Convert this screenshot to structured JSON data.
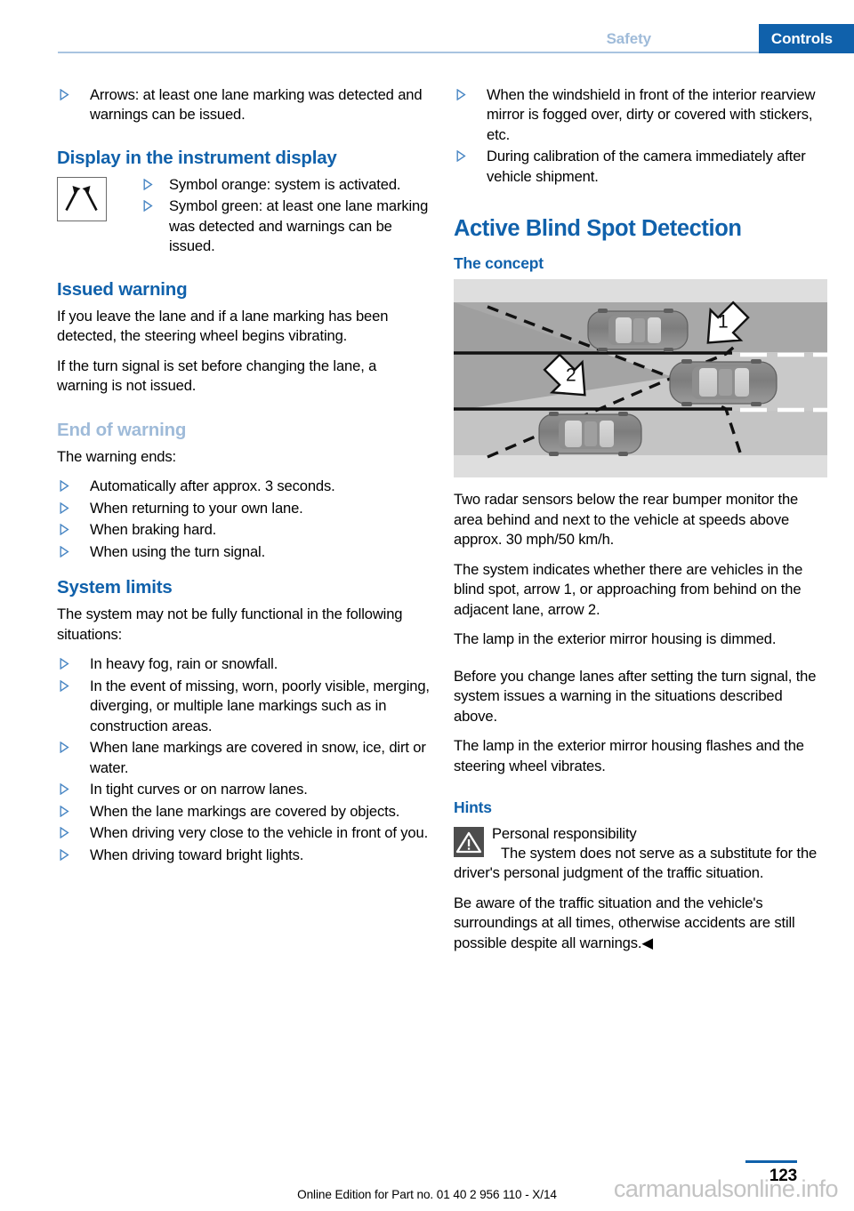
{
  "header": {
    "inactive_tab": "Safety",
    "active_tab": "Controls",
    "accent_color": "#1061ab",
    "faded_color": "#9fbbd9"
  },
  "left_column": {
    "top_bullets": [
      "Arrows: at least one lane marking was detected and warnings can be issued."
    ],
    "display_heading": "Display in the instrument display",
    "symbol_icon": "lane-departure-warning-icon",
    "symbol_bullets": [
      "Symbol orange: system is activated.",
      "Symbol green: at least one lane marking was detected and warnings can be issued."
    ],
    "issued_warning": {
      "heading": "Issued warning",
      "paragraphs": [
        "If you leave the lane and if a lane marking has been detected, the steering wheel begins vibrating.",
        "If the turn signal is set before changing the lane, a warning is not issued."
      ]
    },
    "end_of_warning": {
      "heading": "End of warning",
      "intro": "The warning ends:",
      "bullets": [
        "Automatically after approx. 3 seconds.",
        "When returning to your own lane.",
        "When braking hard.",
        "When using the turn signal."
      ]
    },
    "system_limits": {
      "heading": "System limits",
      "intro": "The system may not be fully functional in the following situations:",
      "bullets": [
        "In heavy fog, rain or snowfall.",
        "In the event of missing, worn, poorly visible, merging, diverging, or multiple lane markings such as in construction areas.",
        "When lane markings are covered in snow, ice, dirt or water.",
        "In tight curves or on narrow lanes.",
        "When the lane markings are covered by objects.",
        "When driving very close to the vehicle in front of you.",
        "When driving toward bright lights."
      ]
    }
  },
  "right_column": {
    "top_bullets": [
      "When the windshield in front of the interior rearview mirror is fogged over, dirty or covered with stickers, etc.",
      "During calibration of the camera immediately after vehicle shipment."
    ],
    "section_title": "Active Blind Spot Detection",
    "concept_heading": "The concept",
    "figure": {
      "name": "blind-spot-detection-illustration",
      "arrow_labels": [
        "1",
        "2"
      ],
      "description": "Top-down view of a road with three cars, lane markings and dashed radar detection zone boundaries"
    },
    "concept_paragraphs": [
      "Two radar sensors below the rear bumper monitor the area behind and next to the vehicle at speeds above approx. 30 mph/50 km/h.",
      "The system indicates whether there are vehicles in the blind spot, arrow 1, or approaching from behind on the adjacent lane, arrow 2.",
      "The lamp in the exterior mirror housing is dimmed."
    ],
    "warning_paragraphs": [
      "Before you change lanes after setting the turn signal, the system issues a warning in the situations described above.",
      "The lamp in the exterior mirror housing flashes and the steering wheel vibrates."
    ],
    "hints": {
      "heading": "Hints",
      "warning_icon": "warning-triangle-icon",
      "warning_title": "Personal responsibility",
      "warning_body": "The system does not serve as a substitute for the driver's personal judgment of the traffic situation.",
      "closing_paragraph": "Be aware of the traffic situation and the vehicle's surroundings at all times, otherwise accidents are still possible despite all warnings.",
      "closing_marker": "◀"
    }
  },
  "footer": {
    "edition": "Online Edition for Part no. 01 40 2 956 110 - X/14",
    "page_number": "123",
    "watermark": "carmanualsonline.info"
  }
}
